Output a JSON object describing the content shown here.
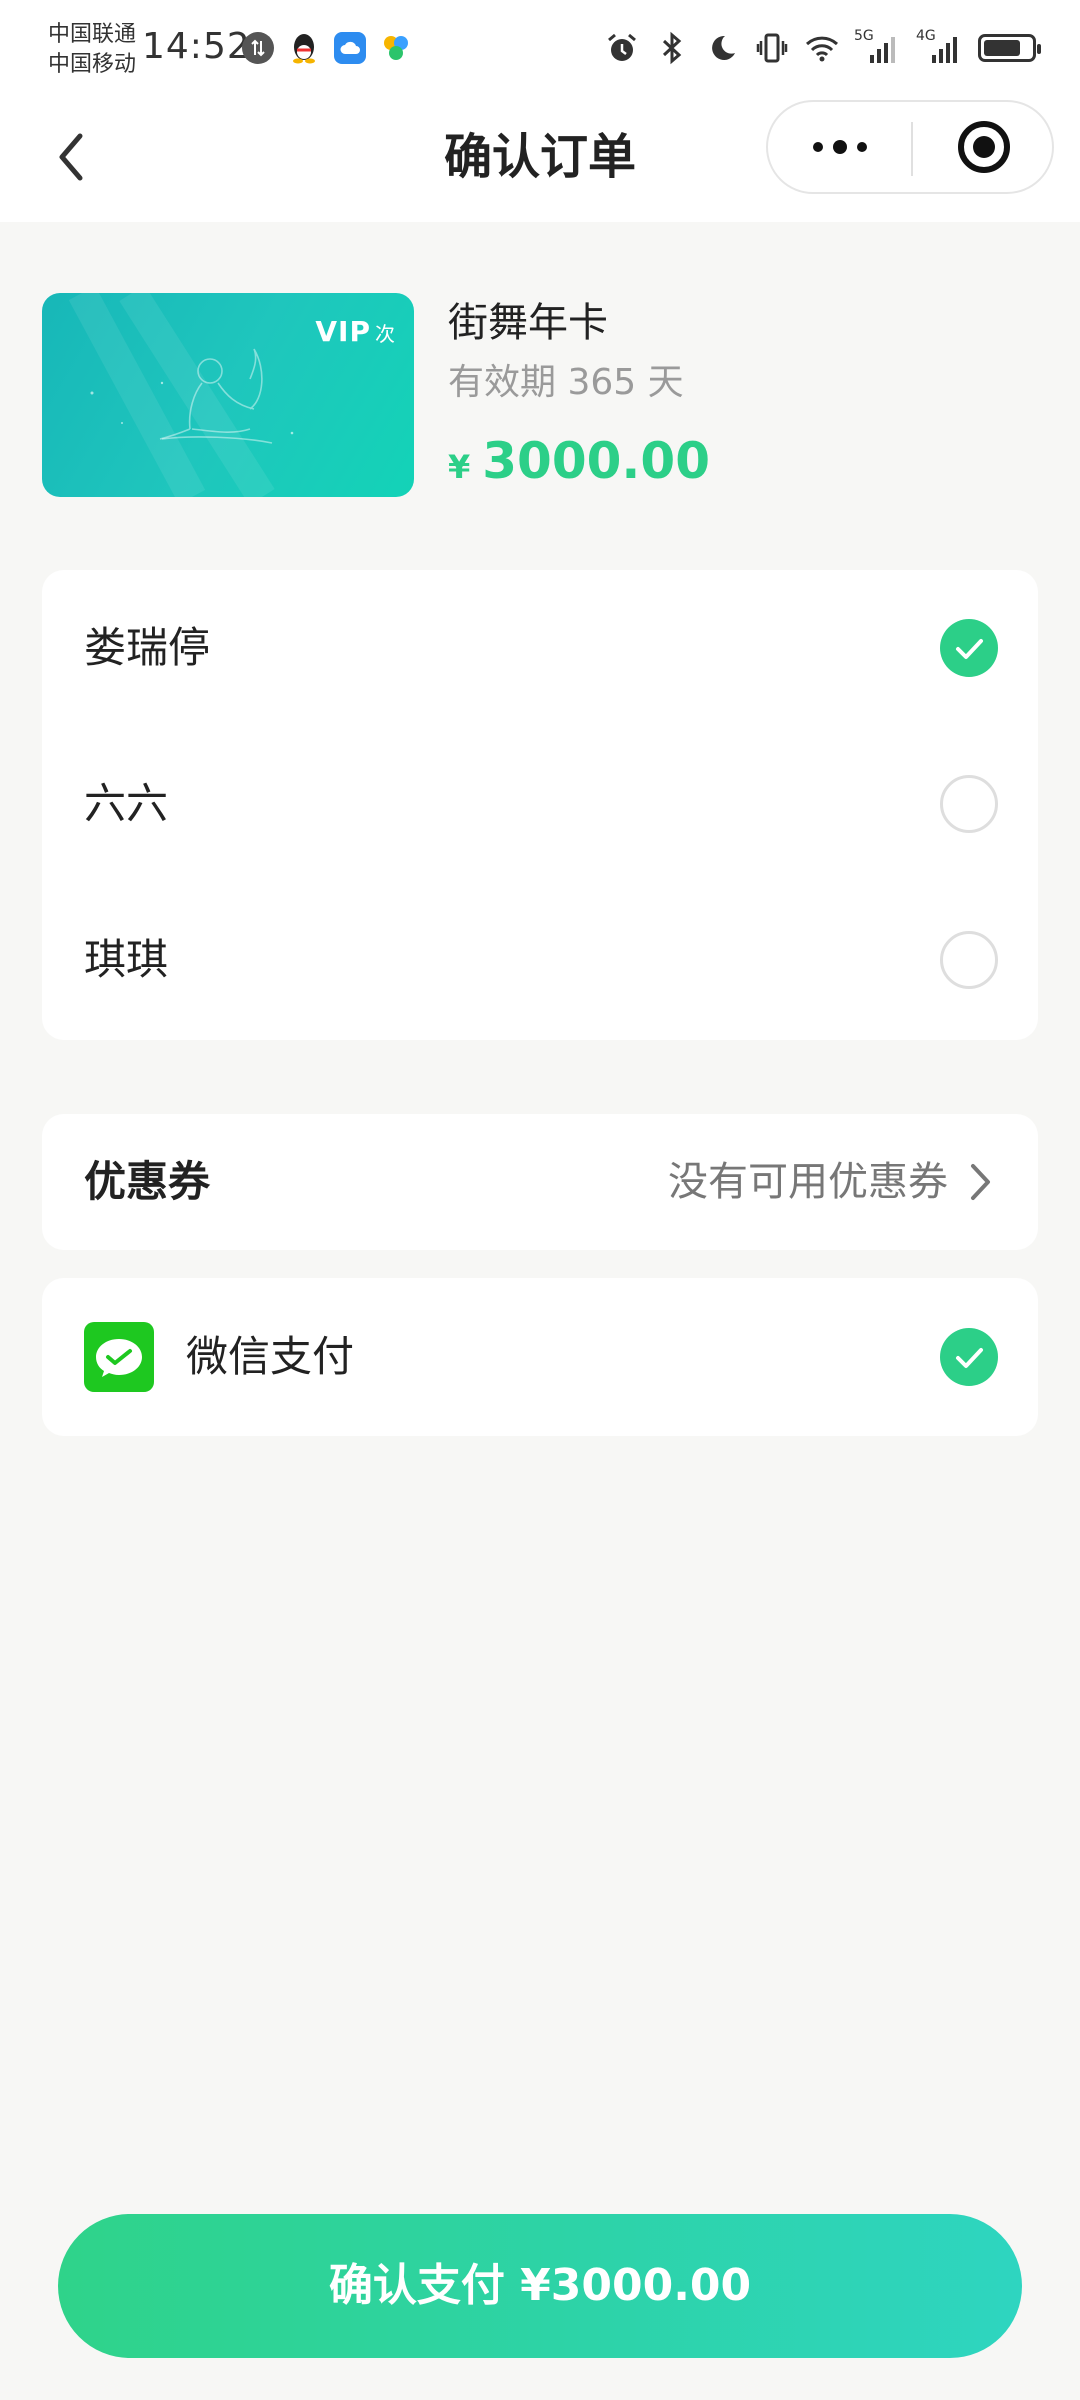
{
  "status_bar": {
    "carrier_1": "中国联通",
    "carrier_2": "中国移动",
    "time": "14:52",
    "network_1": "5G",
    "network_2": "4G"
  },
  "nav": {
    "title": "确认订单"
  },
  "product": {
    "card_badge": "VIP",
    "card_badge_sub": "次",
    "name": "街舞年卡",
    "validity": "有效期 365 天",
    "price_symbol": "¥",
    "price": "3000.00"
  },
  "members": [
    {
      "name": "娄瑞停",
      "selected": true
    },
    {
      "name": "六六",
      "selected": false
    },
    {
      "name": "琪琪",
      "selected": false
    }
  ],
  "coupon": {
    "label": "优惠券",
    "value": "没有可用优惠券"
  },
  "payment": {
    "method": "微信支付",
    "selected": true
  },
  "confirm_button": {
    "label": "确认支付 ¥3000.00"
  },
  "colors": {
    "accent": "#2ccf88",
    "wechat": "#1ec820",
    "background": "#f7f7f5"
  }
}
